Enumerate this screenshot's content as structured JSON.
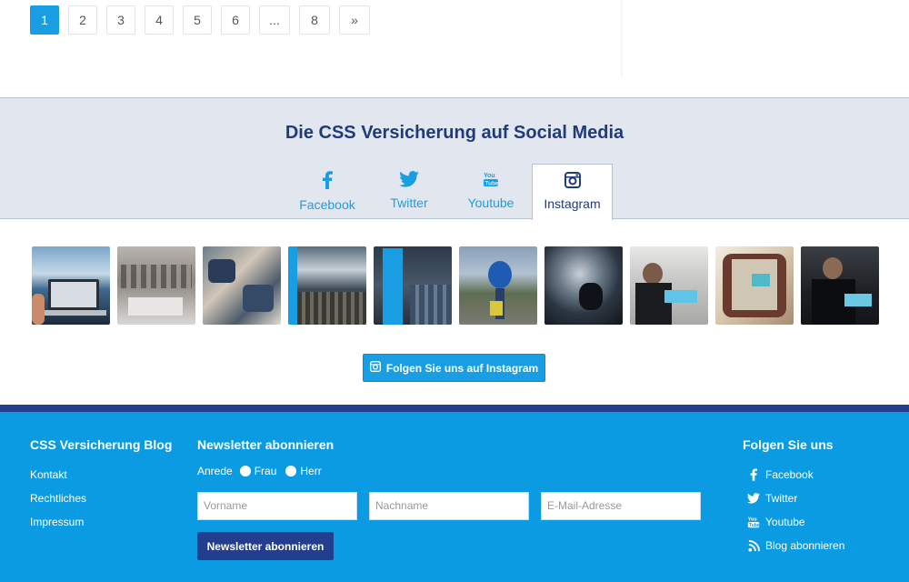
{
  "pagination": {
    "pages": [
      "1",
      "2",
      "3",
      "4",
      "5",
      "6",
      "...",
      "8",
      "»"
    ],
    "active": "1"
  },
  "social": {
    "title": "Die CSS Versicherung auf Social Media",
    "tabs": [
      {
        "label": "Facebook",
        "icon": "facebook-icon"
      },
      {
        "label": "Twitter",
        "icon": "twitter-icon"
      },
      {
        "label": "Youtube",
        "icon": "youtube-icon"
      },
      {
        "label": "Instagram",
        "icon": "instagram-icon"
      }
    ],
    "active_tab": "Instagram",
    "follow_button": "Folgen Sie uns auf Instagram"
  },
  "footer": {
    "blog_heading": "CSS Versicherung Blog",
    "links": [
      "Kontakt",
      "Rechtliches",
      "Impressum"
    ],
    "newsletter": {
      "heading": "Newsletter abonnieren",
      "anrede_label": "Anrede",
      "options": [
        "Frau",
        "Herr"
      ],
      "firstname_placeholder": "Vorname",
      "lastname_placeholder": "Nachname",
      "email_placeholder": "E-Mail-Adresse",
      "submit_label": "Newsletter abonnieren"
    },
    "follow": {
      "heading": "Folgen Sie uns",
      "items": [
        {
          "label": "Facebook",
          "icon": "facebook-icon"
        },
        {
          "label": "Twitter",
          "icon": "twitter-icon"
        },
        {
          "label": "Youtube",
          "icon": "youtube-icon"
        },
        {
          "label": "Blog abonnieren",
          "icon": "rss-icon"
        }
      ]
    }
  },
  "colors": {
    "primary_blue": "#1a9ee3",
    "navy": "#1f3b7a",
    "footer_bg": "#0a9be3",
    "footer_stripe": "#233e8e",
    "section_bg": "#e2e6ee"
  }
}
